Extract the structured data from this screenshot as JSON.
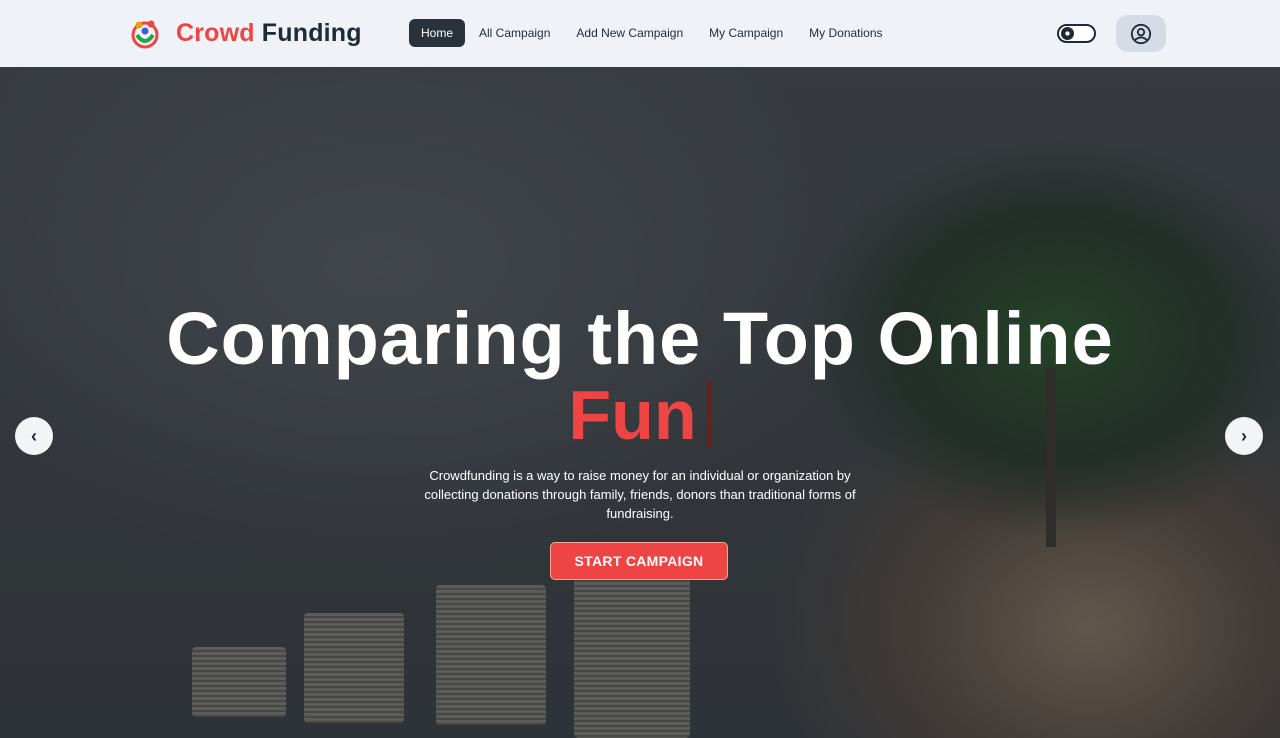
{
  "brand": {
    "name_part1": "Crowd",
    "name_part2": "Funding"
  },
  "nav": {
    "items": [
      {
        "label": "Home",
        "active": true
      },
      {
        "label": "All Campaign",
        "active": false
      },
      {
        "label": "Add New Campaign",
        "active": false
      },
      {
        "label": "My Campaign",
        "active": false
      },
      {
        "label": "My Donations",
        "active": false
      }
    ],
    "theme_toggle_icon": "sun-icon",
    "profile_icon": "user-circle-icon"
  },
  "hero": {
    "title": "Comparing the Top Online",
    "typed_text": "Fun",
    "description": "Crowdfunding is a way to raise money for an individual or organization by collecting donations through family, friends, donors than traditional forms of fundraising.",
    "cta_label": "START CAMPAIGN",
    "prev_arrow": "‹",
    "next_arrow": "›"
  },
  "colors": {
    "accent": "#ef4444",
    "dark": "#1f2937",
    "navbar_bg": "#eff3f8"
  }
}
